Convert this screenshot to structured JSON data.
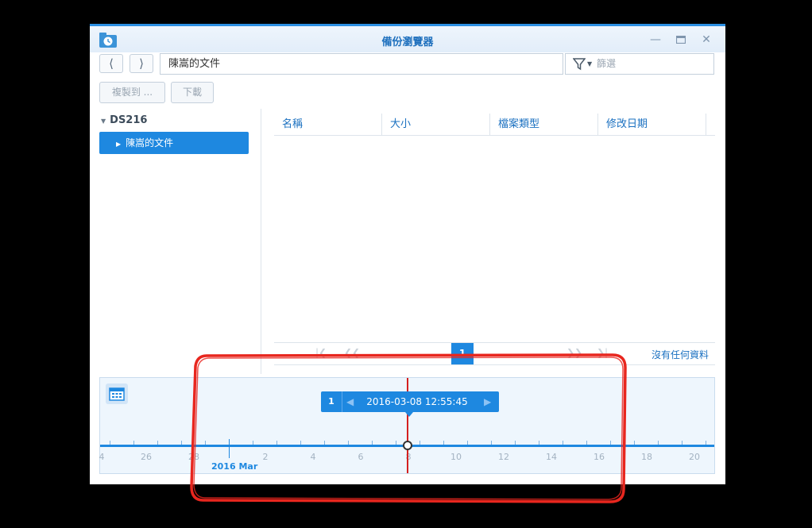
{
  "window": {
    "title": "備份瀏覽器",
    "app_icon": "backup-explorer-icon",
    "controls": [
      "minimize-icon",
      "maximize-icon",
      "close-icon"
    ]
  },
  "toolbar": {
    "back_icon": "chevron-left-icon",
    "forward_icon": "chevron-right-icon",
    "path": "陳嵩的文件",
    "filter_placeholder": "篩選",
    "copy_to_label": "複製到 ...",
    "download_label": "下載"
  },
  "tree": {
    "root": "DS216",
    "selected": "陳嵩的文件"
  },
  "grid": {
    "columns": [
      "名稱",
      "大小",
      "檔案類型",
      "修改日期"
    ],
    "rows": []
  },
  "pager": {
    "current_page": "1",
    "status": "沒有任何資料"
  },
  "timeline": {
    "version_count": "1",
    "selected_datetime": "2016-03-08 12:55:45",
    "month_label": "2016 Mar",
    "tick_labels": [
      "4",
      "26",
      "28",
      "2",
      "4",
      "6",
      "8",
      "10",
      "12",
      "14",
      "16",
      "18",
      "20"
    ],
    "accent_color": "#1e88e0",
    "cursor_color": "#d42020"
  },
  "annotation": {
    "color": "#e8261e",
    "shape": "hand-drawn rounded rectangle around timeline"
  }
}
